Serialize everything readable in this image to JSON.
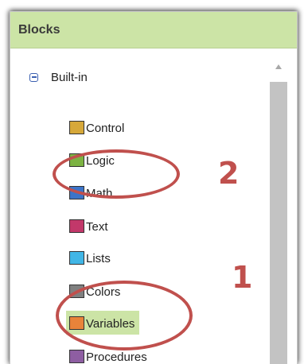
{
  "panel": {
    "title": "Blocks"
  },
  "tree": {
    "root": {
      "label": "Built-in"
    },
    "items": [
      {
        "label": "Control",
        "color": "#d6a83a"
      },
      {
        "label": "Logic",
        "color": "#7cb342"
      },
      {
        "label": "Math",
        "color": "#3c74c9"
      },
      {
        "label": "Text",
        "color": "#c2386a"
      },
      {
        "label": "Lists",
        "color": "#41b6e6"
      },
      {
        "label": "Colors",
        "color": "#808080"
      },
      {
        "label": "Variables",
        "color": "#e8833a",
        "selected": true
      },
      {
        "label": "Procedures",
        "color": "#8e5ea2"
      }
    ]
  },
  "annotations": [
    {
      "number": "2",
      "target": "Math"
    },
    {
      "number": "1",
      "target": "Variables"
    }
  ],
  "colors": {
    "header_bg": "#cce4a6",
    "annotation": "#c0504d",
    "selected_bg": "#cce4a6"
  }
}
